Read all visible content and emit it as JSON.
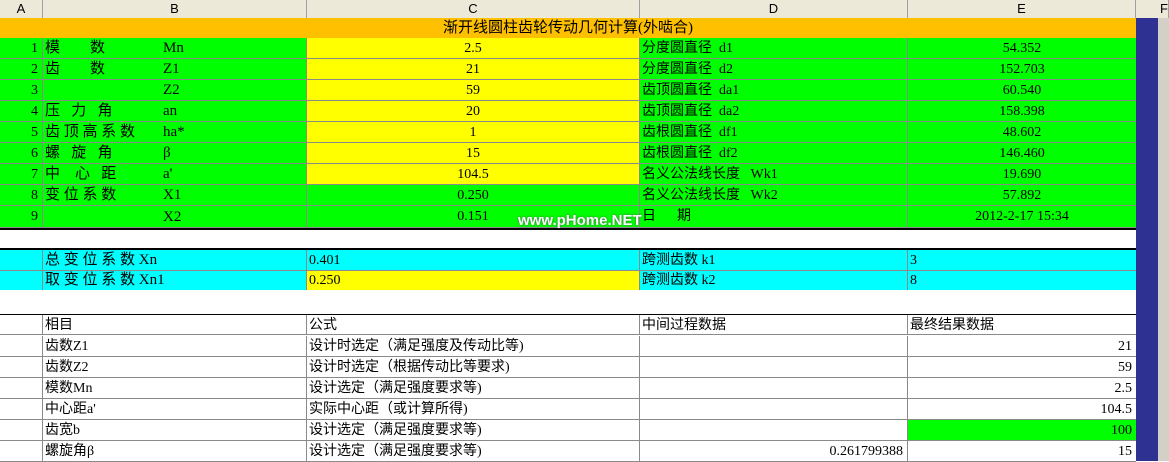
{
  "columns": [
    "A",
    "B",
    "C",
    "D",
    "E",
    "F"
  ],
  "title": "渐开线圆柱齿轮传动几何计算(外啮合)",
  "params": [
    {
      "idx": "1",
      "label": "模        数",
      "sym": "Mn",
      "val": "2.5",
      "dlabel": "分度圆直径  d1",
      "dval": "54.352"
    },
    {
      "idx": "2",
      "label": "齿        数",
      "sym": "Z1",
      "val": "21",
      "dlabel": "分度圆直径  d2",
      "dval": "152.703"
    },
    {
      "idx": "3",
      "label": "",
      "sym": "Z2",
      "val": "59",
      "dlabel": "齿顶圆直径  da1",
      "dval": "60.540"
    },
    {
      "idx": "4",
      "label": "压   力   角",
      "sym": "an",
      "val": "20",
      "dlabel": "齿顶圆直径  da2",
      "dval": "158.398"
    },
    {
      "idx": "5",
      "label": "齿 顶 高 系 数",
      "sym": "ha*",
      "val": "1",
      "dlabel": "齿根圆直径  df1",
      "dval": "48.602"
    },
    {
      "idx": "6",
      "label": "螺   旋   角",
      "sym": "β",
      "val": "15",
      "dlabel": "齿根圆直径  df2",
      "dval": "146.460"
    },
    {
      "idx": "7",
      "label": "中    心   距",
      "sym": "a'",
      "val": "104.5",
      "dlabel": "名义公法线长度   Wk1",
      "dval": "19.690"
    },
    {
      "idx": "8",
      "label": "变 位 系 数",
      "sym": "X1",
      "val": "0.250",
      "dlabel": "名义公法线长度   Wk2",
      "dval": "57.892"
    },
    {
      "idx": "9",
      "label": "",
      "sym": "X2",
      "val": "0.151",
      "dlabel": "日      期",
      "dval": "2012-2-17 15:34"
    }
  ],
  "summary": [
    {
      "label": "总 变 位 系 数 Xn",
      "val": "0.401",
      "dlabel": "跨测齿数 k1",
      "dval": "3"
    },
    {
      "label": "取 变 位 系 数 Xn1",
      "val": "0.250",
      "dlabel": "跨测齿数 k2",
      "dval": "8"
    }
  ],
  "table_headers": {
    "item": "相目",
    "formula": "公式",
    "mid": "中间过程数据",
    "final": "最终结果数据"
  },
  "table_rows": [
    {
      "item": "齿数Z1",
      "formula": "设计时选定（满足强度及传动比等)",
      "mid": "",
      "final": "21"
    },
    {
      "item": "齿数Z2",
      "formula": "设计时选定（根据传动比等要求)",
      "mid": "",
      "final": "59"
    },
    {
      "item": "模数Mn",
      "formula": "设计选定（满足强度要求等)",
      "mid": "",
      "final": "2.5"
    },
    {
      "item": "中心距a'",
      "formula": "实际中心距（或计算所得)",
      "mid": "",
      "final": "104.5"
    },
    {
      "item": "齿宽b",
      "formula": "设计选定（满足强度要求等)",
      "mid": "",
      "final": "100"
    },
    {
      "item": "螺旋角β",
      "formula": "设计选定（满足强度要求等)",
      "mid": "0.261799388",
      "final": "15"
    }
  ],
  "watermark": "www.pHome.NET",
  "colors": {
    "green": "#00ff00",
    "yellow": "#ffff00",
    "cyan": "#00ffff",
    "orange": "#ffc000",
    "blue": "#2e3192"
  }
}
